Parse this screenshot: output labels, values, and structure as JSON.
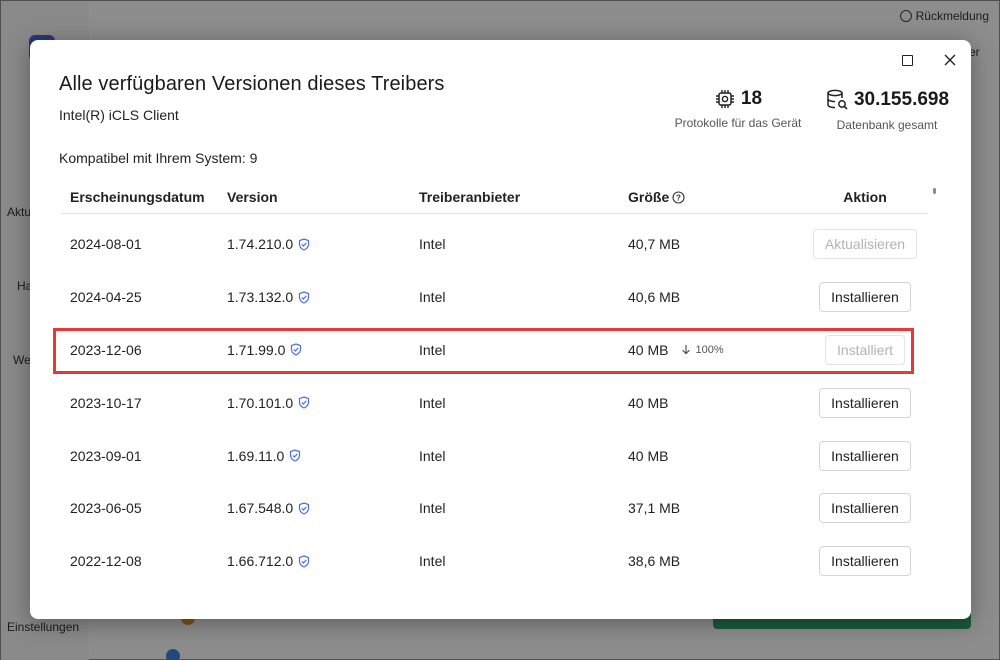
{
  "background": {
    "feedback": "Rückmeldung",
    "peek": "er",
    "sidebar": [
      "Aktu",
      "Ha",
      "We",
      "Einstellungen"
    ]
  },
  "dialog": {
    "title": "Alle verfügbaren Versionen dieses Treibers",
    "driver_name": "Intel(R) iCLS Client",
    "compatible": "Kompatibel mit Ihrem System: 9",
    "stats": [
      {
        "value": "18",
        "label": "Protokolle für das Gerät",
        "icon": "chip-icon"
      },
      {
        "value": "30.155.698",
        "label": "Datenbank gesamt",
        "icon": "database-search-icon"
      }
    ],
    "columns": {
      "date": "Erscheinungsdatum",
      "version": "Version",
      "vendor": "Treiberanbieter",
      "size": "Größe",
      "action": "Aktion"
    },
    "rows": [
      {
        "date": "2024-08-01",
        "version": "1.74.210.0",
        "vendor": "Intel",
        "size": "40,7 MB",
        "action": "Aktualisieren",
        "disabled": true
      },
      {
        "date": "2024-04-25",
        "version": "1.73.132.0",
        "vendor": "Intel",
        "size": "40,6 MB",
        "action": "Installieren",
        "disabled": false
      },
      {
        "date": "2023-12-06",
        "version": "1.71.99.0",
        "vendor": "Intel",
        "size": "40 MB",
        "progress": "100%",
        "action": "Installiert",
        "disabled": true,
        "highlighted": true
      },
      {
        "date": "2023-10-17",
        "version": "1.70.101.0",
        "vendor": "Intel",
        "size": "40 MB",
        "action": "Installieren",
        "disabled": false
      },
      {
        "date": "2023-09-01",
        "version": "1.69.11.0",
        "vendor": "Intel",
        "size": "40 MB",
        "action": "Installieren",
        "disabled": false
      },
      {
        "date": "2023-06-05",
        "version": "1.67.548.0",
        "vendor": "Intel",
        "size": "37,1 MB",
        "action": "Installieren",
        "disabled": false
      },
      {
        "date": "2022-12-08",
        "version": "1.66.712.0",
        "vendor": "Intel",
        "size": "38,6 MB",
        "action": "Installieren",
        "disabled": false
      }
    ],
    "colors": {
      "accent": "#4a6fdc",
      "highlight": "#e53935"
    }
  }
}
